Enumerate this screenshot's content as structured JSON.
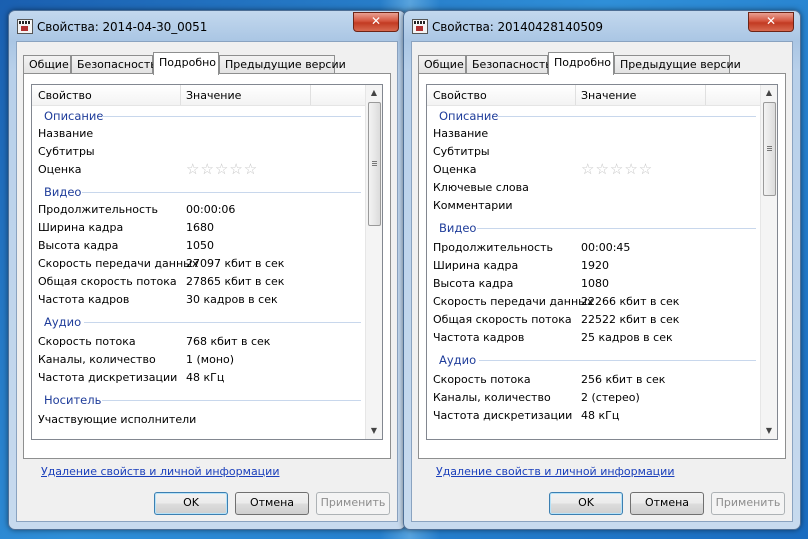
{
  "windows": [
    {
      "title": "Свойства: 2014-04-30_0051",
      "close_label": "✕",
      "tabs": [
        "Общие",
        "Безопасность",
        "Подробно",
        "Предыдущие версии"
      ],
      "active_tab": "Подробно",
      "header": {
        "col_property": "Свойство",
        "col_value": "Значение"
      },
      "groups": [
        {
          "name": "Описание",
          "rows": [
            {
              "k": "Название",
              "v": ""
            },
            {
              "k": "Субтитры",
              "v": ""
            },
            {
              "k": "Оценка",
              "v": "☆☆☆☆☆"
            }
          ]
        },
        {
          "name": "Видео",
          "rows": [
            {
              "k": "Продолжительность",
              "v": "00:00:06"
            },
            {
              "k": "Ширина кадра",
              "v": "1680"
            },
            {
              "k": "Высота кадра",
              "v": "1050"
            },
            {
              "k": "Скорость передачи данных",
              "v": "27097 кбит в сек"
            },
            {
              "k": "Общая скорость потока",
              "v": "27865 кбит в сек"
            },
            {
              "k": "Частота кадров",
              "v": "30 кадров в сек"
            }
          ]
        },
        {
          "name": "Аудио",
          "rows": [
            {
              "k": "Скорость потока",
              "v": "768 кбит в сек"
            },
            {
              "k": "Каналы, количество",
              "v": "1 (моно)"
            },
            {
              "k": "Частота дискретизации",
              "v": "48 кГц"
            }
          ]
        },
        {
          "name": "Носитель",
          "rows": [
            {
              "k": "Участвующие исполнители",
              "v": ""
            }
          ]
        }
      ],
      "link_text": "Удаление свойств и личной информации",
      "buttons": {
        "ok": "OK",
        "cancel": "Отмена",
        "apply": "Применить"
      }
    },
    {
      "title": "Свойства: 20140428140509",
      "close_label": "✕",
      "tabs": [
        "Общие",
        "Безопасность",
        "Подробно",
        "Предыдущие версии"
      ],
      "active_tab": "Подробно",
      "header": {
        "col_property": "Свойство",
        "col_value": "Значение"
      },
      "groups": [
        {
          "name": "Описание",
          "rows": [
            {
              "k": "Название",
              "v": ""
            },
            {
              "k": "Субтитры",
              "v": ""
            },
            {
              "k": "Оценка",
              "v": "☆☆☆☆☆"
            },
            {
              "k": "Ключевые слова",
              "v": ""
            },
            {
              "k": "Комментарии",
              "v": ""
            }
          ]
        },
        {
          "name": "Видео",
          "rows": [
            {
              "k": "Продолжительность",
              "v": "00:00:45"
            },
            {
              "k": "Ширина кадра",
              "v": "1920"
            },
            {
              "k": "Высота кадра",
              "v": "1080"
            },
            {
              "k": "Скорость передачи данных",
              "v": "22266 кбит в сек"
            },
            {
              "k": "Общая скорость потока",
              "v": "22522 кбит в сек"
            },
            {
              "k": "Частота кадров",
              "v": "25 кадров в сек"
            }
          ]
        },
        {
          "name": "Аудио",
          "rows": [
            {
              "k": "Скорость потока",
              "v": "256 кбит в сек"
            },
            {
              "k": "Каналы, количество",
              "v": "2 (стерео)"
            },
            {
              "k": "Частота дискретизации",
              "v": "48 кГц"
            }
          ]
        }
      ],
      "link_text": "Удаление свойств и личной информации",
      "buttons": {
        "ok": "OK",
        "cancel": "Отмена",
        "apply": "Применить"
      }
    }
  ],
  "colors": {
    "group_header": "#1e3c9a",
    "link": "#1a3fbb",
    "close_button": "#c23a22"
  }
}
